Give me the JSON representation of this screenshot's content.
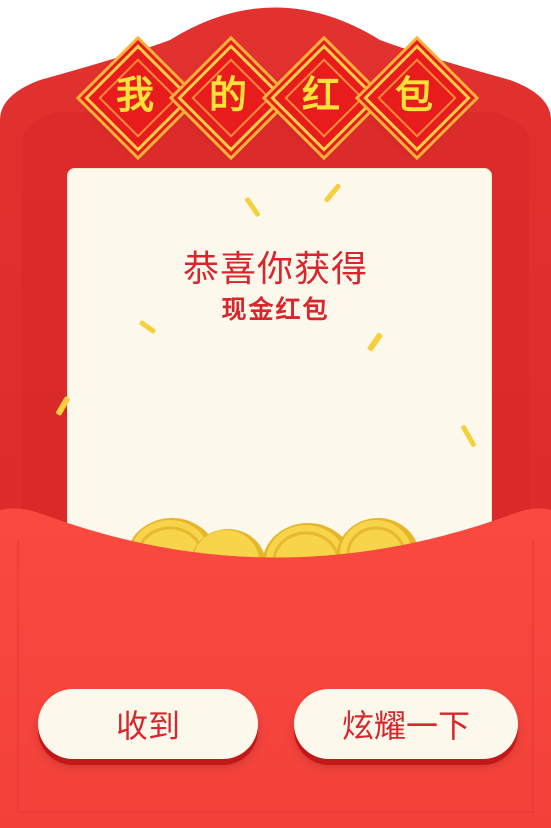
{
  "title_chars": [
    "我",
    "的",
    "红",
    "包"
  ],
  "card": {
    "title": "恭喜你获得",
    "subtitle": "现金红包"
  },
  "buttons": {
    "receive_label": "收到",
    "show_off_label": "炫耀一下"
  },
  "colors": {
    "envelope_red": "#e8302e",
    "envelope_front": "#f8463c",
    "card_bg": "#fdf8ec",
    "accent_text": "#d8262c",
    "gold": "#f5cf3c"
  }
}
